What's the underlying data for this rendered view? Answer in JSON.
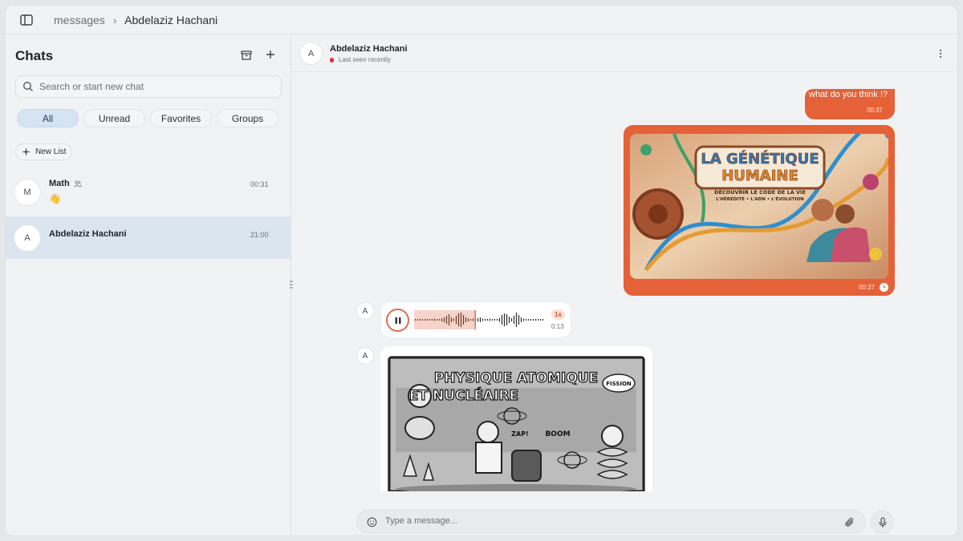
{
  "topbar": {
    "sidebar_toggle_icon": "sidebar-panel-icon",
    "breadcrumb": [
      "messages",
      "Abdelaziz Hachani"
    ],
    "separator_icon": "chevron-right-icon"
  },
  "sidebar": {
    "title": "Chats",
    "archive_icon": "archive-icon",
    "new_chat_icon": "plus-icon",
    "search": {
      "placeholder": "Search or start new chat",
      "value": ""
    },
    "filters": [
      {
        "label": "All",
        "active": true
      },
      {
        "label": "Unread",
        "active": false
      },
      {
        "label": "Favorites",
        "active": false
      },
      {
        "label": "Groups",
        "active": false
      }
    ],
    "new_list_label": "New List",
    "chats": [
      {
        "initial": "M",
        "name": "Math",
        "is_group": true,
        "time": "00:31",
        "preview": "👋",
        "active": false
      },
      {
        "initial": "A",
        "name": "Abdelaziz Hachani",
        "is_group": false,
        "time": "21:00",
        "preview": "",
        "active": true
      }
    ]
  },
  "conversation": {
    "peer": {
      "initial": "A",
      "name": "Abdelaziz Hachani",
      "status": "Last seen recently"
    },
    "messages": [
      {
        "from": "me",
        "type": "text",
        "text": "what do you think !?",
        "time": "00:37"
      },
      {
        "from": "me",
        "type": "image",
        "subject": "La Génétique Humaine illustration",
        "time": "00:37"
      },
      {
        "from": "peer",
        "initial": "A",
        "type": "voice",
        "speed": "1x",
        "duration": "0:13",
        "progress": 0.47
      },
      {
        "from": "peer",
        "initial": "A",
        "type": "image",
        "subject": "Physique Atomique et Nucléaire illustration"
      }
    ],
    "image_texts": {
      "gen_title_1": "LA GÉNÉTIQUE",
      "gen_title_2": "HUMAINE",
      "gen_sub_1": "DÉCOUVRIR LE CODE DE LA VIE",
      "gen_sub_2": "L'HÉRÉDITÉ • L'ADN • L'ÉVOLUTION",
      "phys_title_1": "PHYSIQUE ATOMIQUE",
      "phys_title_2": "ET NUCLÉAIRE",
      "phys_fission": "FISSION",
      "phys_zap": "ZAP!",
      "phys_boom": "BOOM"
    }
  },
  "composer": {
    "placeholder": "Type a message...",
    "value": ""
  },
  "colors": {
    "accent": "#e56138",
    "active_chat": "#dbe5ef",
    "active_chip": "#d5e3f3"
  }
}
